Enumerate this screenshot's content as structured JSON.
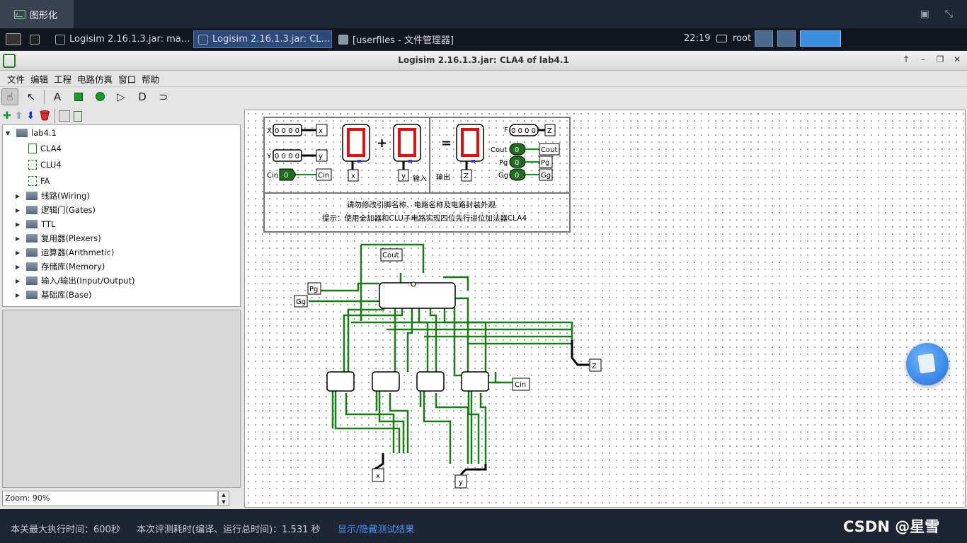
{
  "topbar": {
    "tab_label": "图形化"
  },
  "taskbar": {
    "items": [
      {
        "label": "Logisim 2.16.1.3.jar: ma…"
      },
      {
        "label": "Logisim 2.16.1.3.jar: CL…"
      },
      {
        "label": "[userfiles - 文件管理器]"
      }
    ],
    "clock": "22:19",
    "user": "root"
  },
  "window": {
    "title": "Logisim 2.16.1.3.jar: CLA4 of lab4.1",
    "controls": [
      "↑",
      "–",
      "❐",
      "✕"
    ]
  },
  "menu": [
    "文件",
    "编辑",
    "工程",
    "电路仿真",
    "窗口",
    "帮助"
  ],
  "explorer": {
    "root": "lab4.1",
    "circuits": [
      "CLA4",
      "CLU4",
      "FA"
    ],
    "libraries": [
      "线路(Wiring)",
      "逻辑门(Gates)",
      "TTL",
      "复用器(Plexers)",
      "运算器(Arithmetic)",
      "存储库(Memory)",
      "输入/输出(Input/Output)",
      "基础库(Base)"
    ]
  },
  "zoom": "Zoom:  90%",
  "canvas": {
    "x_label": "X",
    "x_bits": "0 0 0 0",
    "x_pin": "x",
    "y_label": "Y",
    "y_bits": "0 0 0 0",
    "y_pin": "y",
    "cin_label": "Cin",
    "cin_val": "0",
    "cin_pin": "Cin",
    "plus": "+",
    "equals": "=",
    "input_label": "输入",
    "output_label": "输出",
    "f_label": "F",
    "f_bits": "0 0 0 0",
    "z_pin": "Z",
    "cout_label": "Cout",
    "cout_val": "0",
    "cout_pin": "Cout",
    "pg_label": "Pg",
    "pg_val": "0",
    "pg_pin": "Pg",
    "gg_label": "Gg",
    "gg_val": "0",
    "gg_pin": "Gg",
    "notice1": "请勿修改引脚名称、电路名称及电路封装外观",
    "notice2": "提示：使用全加器和CLU子电路实现四位先行进位加法器CLA4",
    "pins": {
      "cout": "Cout",
      "pg": "Pg",
      "gg": "Gg",
      "z": "Z",
      "cin": "Cin",
      "x": "x",
      "y": "y"
    }
  },
  "status": {
    "max_time": "本关最大执行时间：600秒",
    "eval_time": "本次评测耗时(编译、运行总时间)：1.531 秒",
    "toggle": "显示/隐藏测试结果",
    "watermark": "CSDN @星雪"
  }
}
